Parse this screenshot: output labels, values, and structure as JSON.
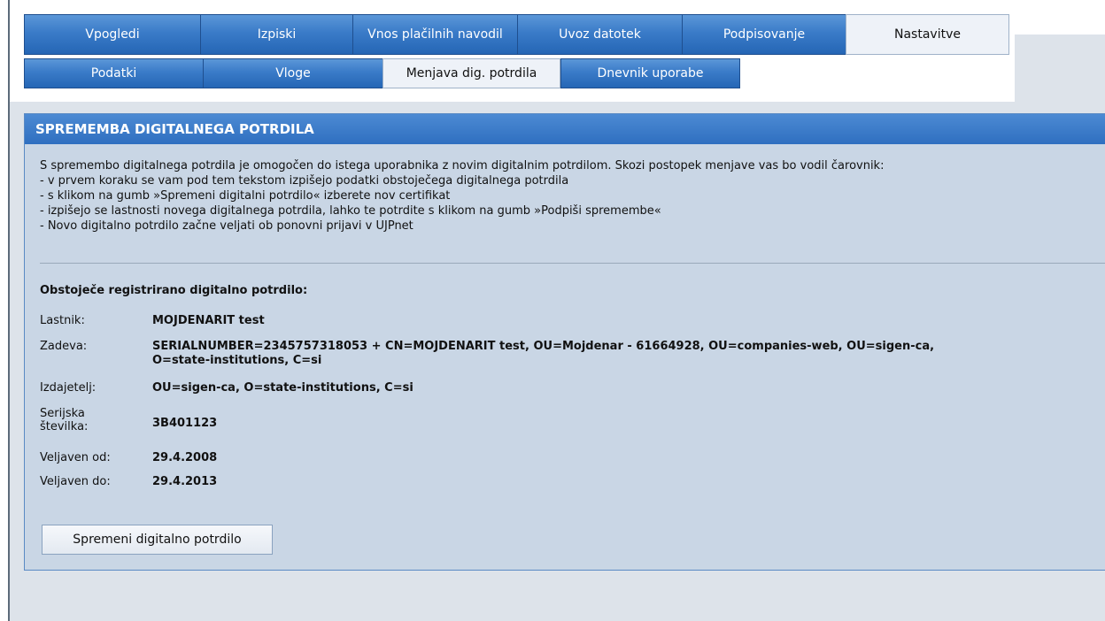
{
  "nav": {
    "main_tabs": [
      {
        "label": "Vpogledi"
      },
      {
        "label": "Izpiski"
      },
      {
        "label": "Vnos plačilnih navodil"
      },
      {
        "label": "Uvoz datotek"
      },
      {
        "label": "Podpisovanje"
      },
      {
        "label": "Nastavitve",
        "active": true
      }
    ],
    "sub_tabs": [
      {
        "label": "Podatki"
      },
      {
        "label": "Vloge"
      },
      {
        "label": "Menjava dig. potrdila",
        "active": true
      },
      {
        "label": "Dnevnik uporabe"
      }
    ]
  },
  "panel": {
    "title": "SPREMEMBA DIGITALNEGA POTRDILA",
    "intro_lines": [
      "S spremembo digitalnega potrdila je omogočen do istega uporabnika z novim digitalnim potrdilom. Skozi postopek menjave vas bo vodil čarovnik:",
      "- v prvem koraku se vam pod tem tekstom izpišejo podatki obstoječega digitalnega potrdila",
      "- s klikom na gumb »Spremeni digitalni potrdilo« izberete nov certifikat",
      "- izpišejo se lastnosti novega digitalnega potrdila, lahko te potrdite s klikom na gumb »Podpiši spremembe«",
      "- Novo digitalno potrdilo začne veljati ob ponovni prijavi v UJPnet"
    ],
    "section_title": "Obstoječe registrirano digitalno potrdilo:",
    "fields": {
      "owner": {
        "label": "Lastnik:",
        "value": "MOJDENARIT test"
      },
      "subject": {
        "label": "Zadeva:",
        "value_line1": "SERIALNUMBER=2345757318053 + CN=MOJDENARIT test, OU=Mojdenar - 61664928, OU=companies-web, OU=sigen-ca,",
        "value_line2": "O=state-institutions, C=si"
      },
      "issuer": {
        "label": "Izdajetelj:",
        "value": "OU=sigen-ca, O=state-institutions, C=si"
      },
      "serial": {
        "label_line1": "Serijska",
        "label_line2": "številka:",
        "value": "3B401123"
      },
      "valid_from": {
        "label": "Veljaven od:",
        "value": "29.4.2008"
      },
      "valid_to": {
        "label": "Veljaven do:",
        "value": "29.4.2013"
      }
    },
    "change_button": "Spremeni digitalno potrdilo"
  }
}
